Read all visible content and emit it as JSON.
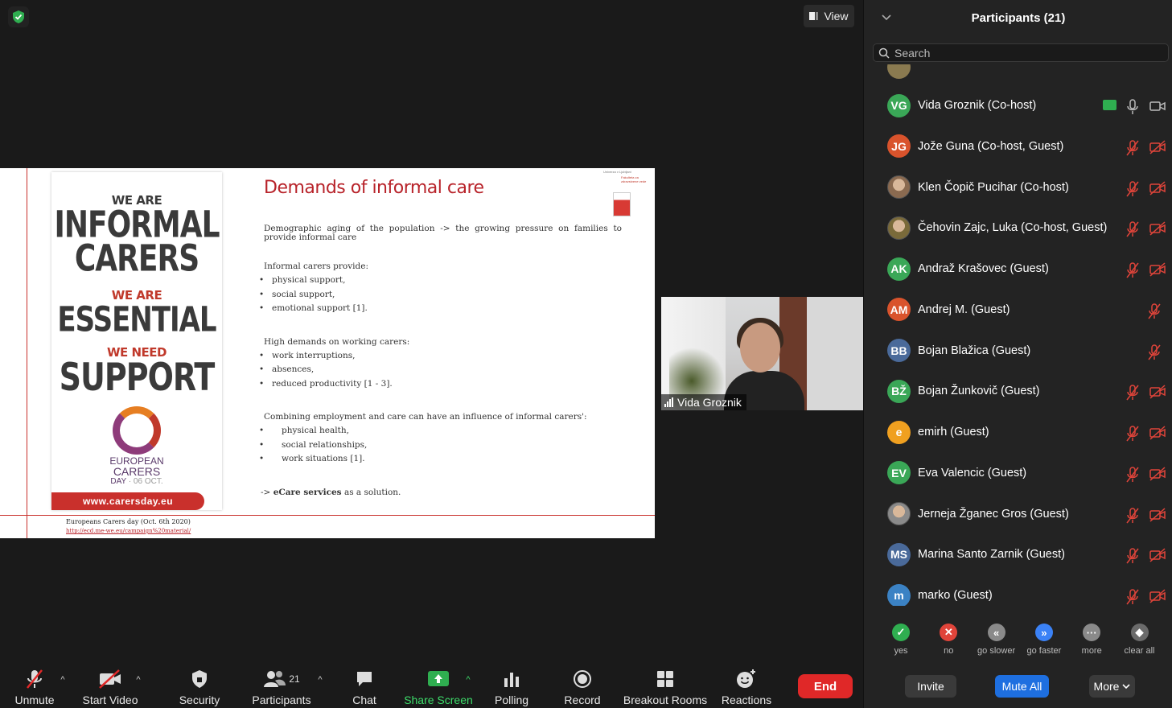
{
  "meeting": {
    "view_label": "View",
    "security_status_icon": "shield-check-icon"
  },
  "slide": {
    "title": "Demands of informal care",
    "intro": "Demographic aging of the population -> the growing pressure on families to provide informal care",
    "section1_heading": "Informal carers provide:",
    "section1_items": [
      "physical support,",
      "social support,",
      "emotional support [1]."
    ],
    "section2_heading": "High demands on working carers:",
    "section2_items": [
      "work interruptions,",
      "absences,",
      "reduced productivity [1 - 3]."
    ],
    "section3_heading": "Combining employment and care can have an influence of informal carers':",
    "section3_items": [
      "physical health,",
      "social relationships,",
      "work situations [1]."
    ],
    "conclusion_prefix": "-> ",
    "conclusion_bold": "eCare services",
    "conclusion_suffix": " as a solution.",
    "footer_cite": "Europeans Carers day (Oct. 6th 2020)",
    "footer_link": "http://ecd.me-we.eu/campaign%20material/",
    "logo_text_1": "Univerza v Ljubljani",
    "logo_text_2": "Fakulteta za zdravstvene vede",
    "poster": {
      "line1": "WE ARE",
      "line2": "INFORMAL",
      "line3": "CARERS",
      "line4": "WE ARE",
      "line5": "ESSENTIAL",
      "line6": "WE NEED",
      "line7": "SUPPORT",
      "brand1": "EUROPEAN",
      "brand2": "CARERS",
      "brand3": "DAY",
      "brand_date": "· 06 OCT.",
      "url": "www.carersday.eu"
    }
  },
  "video": {
    "name": "Vida Groznik"
  },
  "toolbar": {
    "unmute": "Unmute",
    "start_video": "Start Video",
    "security": "Security",
    "participants": "Participants",
    "participants_count": "21",
    "chat": "Chat",
    "share_screen": "Share Screen",
    "polling": "Polling",
    "record": "Record",
    "breakout_rooms": "Breakout Rooms",
    "reactions": "Reactions",
    "end": "End"
  },
  "panel": {
    "title": "Participants (21)",
    "search_placeholder": "Search",
    "participants": [
      {
        "initials": "VG",
        "name": "Vida Groznik (Co-host)",
        "color": "#3aa757",
        "photo": false,
        "sharing": true,
        "mic_muted": false,
        "cam_off": false
      },
      {
        "initials": "JG",
        "name": "Jože Guna (Co-host, Guest)",
        "color": "#d9532c",
        "photo": false,
        "sharing": false,
        "mic_muted": true,
        "cam_off": true
      },
      {
        "initials": "",
        "name": "Klen Čopič Pucihar (Co-host)",
        "color": "#8a6a50",
        "photo": true,
        "sharing": false,
        "mic_muted": true,
        "cam_off": true
      },
      {
        "initials": "",
        "name": "Čehovin Zajc, Luka (Co-host, Guest)",
        "color": "#7a6a3a",
        "photo": true,
        "sharing": false,
        "mic_muted": true,
        "cam_off": true
      },
      {
        "initials": "AK",
        "name": "Andraž Krašovec (Guest)",
        "color": "#3aa757",
        "photo": false,
        "sharing": false,
        "mic_muted": true,
        "cam_off": true
      },
      {
        "initials": "AM",
        "name": "Andrej M. (Guest)",
        "color": "#d9532c",
        "photo": false,
        "sharing": false,
        "mic_muted": true,
        "cam_off": false
      },
      {
        "initials": "BB",
        "name": "Bojan Blažica (Guest)",
        "color": "#4a6a9a",
        "photo": false,
        "sharing": false,
        "mic_muted": true,
        "cam_off": false
      },
      {
        "initials": "BŽ",
        "name": "Bojan Žunkovič (Guest)",
        "color": "#3aa757",
        "photo": false,
        "sharing": false,
        "mic_muted": true,
        "cam_off": true
      },
      {
        "initials": "e",
        "name": "emirh (Guest)",
        "color": "#f0a020",
        "photo": false,
        "sharing": false,
        "mic_muted": true,
        "cam_off": true
      },
      {
        "initials": "EV",
        "name": "Eva Valencic (Guest)",
        "color": "#3aa757",
        "photo": false,
        "sharing": false,
        "mic_muted": true,
        "cam_off": true
      },
      {
        "initials": "",
        "name": "Jerneja Žganec Gros (Guest)",
        "color": "#8a8a8a",
        "photo": true,
        "sharing": false,
        "mic_muted": true,
        "cam_off": true
      },
      {
        "initials": "MS",
        "name": "Marina Santo Zarnik (Guest)",
        "color": "#4a6a9a",
        "photo": false,
        "sharing": false,
        "mic_muted": true,
        "cam_off": true
      },
      {
        "initials": "m",
        "name": "marko (Guest)",
        "color": "#3b82c4",
        "photo": false,
        "sharing": false,
        "mic_muted": true,
        "cam_off": true
      }
    ],
    "feedback": [
      {
        "label": "yes",
        "symbol": "✓",
        "color": "#2fae50"
      },
      {
        "label": "no",
        "symbol": "✕",
        "color": "#e0443a"
      },
      {
        "label": "go slower",
        "symbol": "«",
        "color": "#8a8a8a"
      },
      {
        "label": "go faster",
        "symbol": "»",
        "color": "#3b82f6"
      },
      {
        "label": "more",
        "symbol": "···",
        "color": "#8a8a8a"
      },
      {
        "label": "clear all",
        "symbol": "◆",
        "color": "#6a6a6a"
      }
    ],
    "invite": "Invite",
    "mute_all": "Mute All",
    "more": "More"
  }
}
